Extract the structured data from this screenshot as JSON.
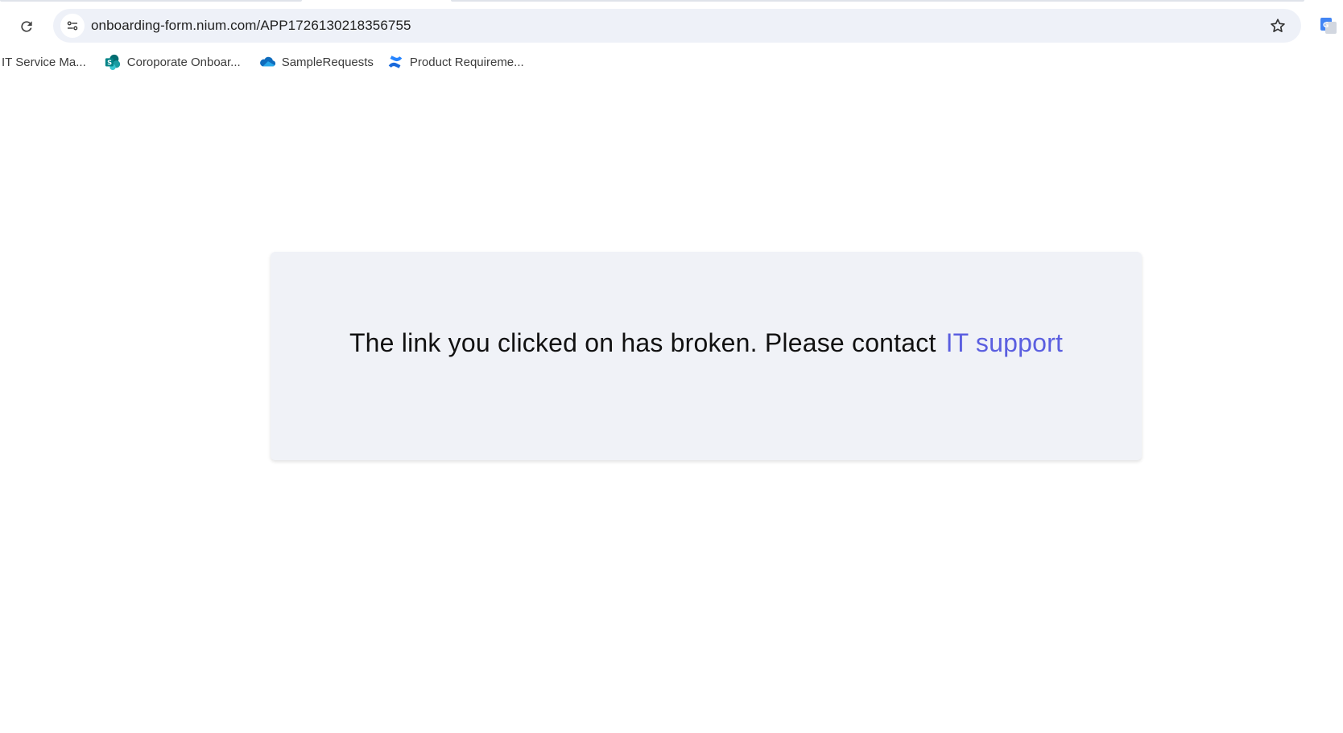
{
  "browser": {
    "url": "onboarding-form.nium.com/APP1726130218356755",
    "bookmarks": [
      {
        "label": "IT Service Ma...",
        "icon": "none"
      },
      {
        "label": "Coroporate Onboar...",
        "icon": "sharepoint-icon"
      },
      {
        "label": "SampleRequests",
        "icon": "onedrive-icon"
      },
      {
        "label": "Product Requireme...",
        "icon": "confluence-icon"
      }
    ]
  },
  "page": {
    "message": "The link you clicked on has broken. Please contact",
    "link_label": "IT support",
    "link_color": "#5b5fe0",
    "card_background": "#f0f2f7"
  }
}
